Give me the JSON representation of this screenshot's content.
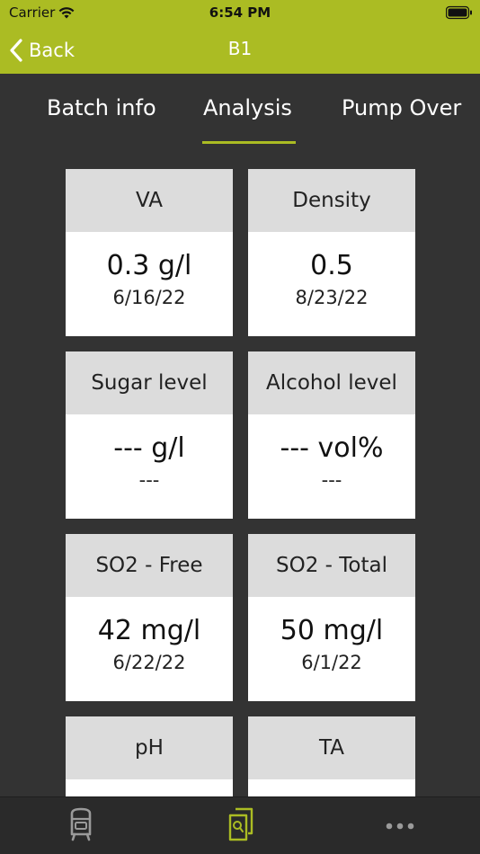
{
  "status_bar": {
    "carrier": "Carrier",
    "time": "6:54 PM"
  },
  "nav": {
    "back_label": "Back",
    "title": "B1"
  },
  "tabs": [
    {
      "label": "Batch info",
      "selected": false
    },
    {
      "label": "Analysis",
      "selected": true
    },
    {
      "label": "Pump Over",
      "selected": false
    }
  ],
  "cards": [
    {
      "title": "VA",
      "value": "0.3 g/l",
      "date": "6/16/22"
    },
    {
      "title": "Density",
      "value": "0.5",
      "date": "8/23/22"
    },
    {
      "title": "Sugar level",
      "value": "--- g/l",
      "date": "---"
    },
    {
      "title": "Alcohol level",
      "value": "--- vol%",
      "date": "---"
    },
    {
      "title": "SO2 - Free",
      "value": "42 mg/l",
      "date": "6/22/22"
    },
    {
      "title": "SO2 - Total",
      "value": "50 mg/l",
      "date": "6/1/22"
    },
    {
      "title": "pH",
      "value": "",
      "date": ""
    },
    {
      "title": "TA",
      "value": "",
      "date": ""
    }
  ],
  "tab_bar": {
    "items": [
      {
        "icon": "tank-icon",
        "selected": false
      },
      {
        "icon": "analysis-documents-icon",
        "selected": true
      },
      {
        "icon": "more-icon",
        "selected": false
      }
    ]
  },
  "colors": {
    "accent": "#abbc23",
    "background": "#333333",
    "card_header": "#dcdcdc",
    "tab_bar": "#2a2a2a",
    "tab_bar_inactive_icon": "#9a9a9a"
  }
}
